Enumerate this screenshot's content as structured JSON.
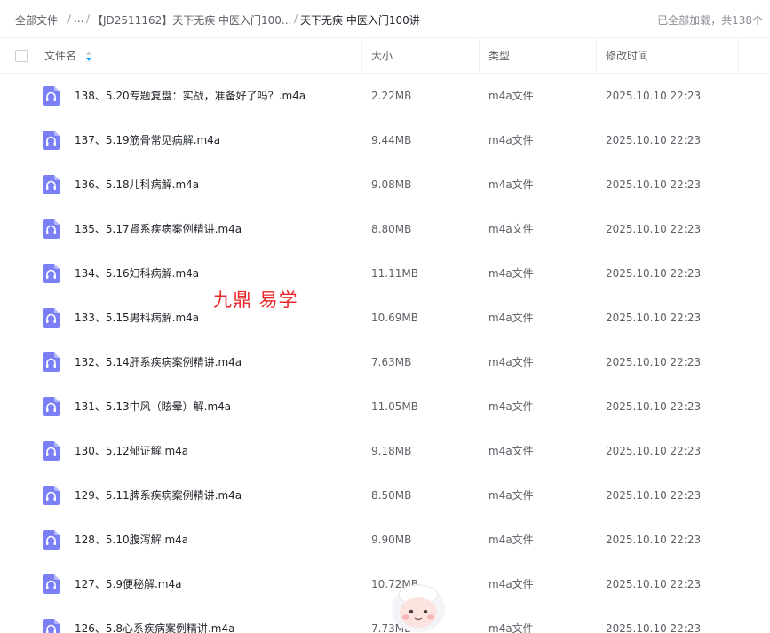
{
  "breadcrumb": {
    "root": "全部文件",
    "ellipsis": "...",
    "folder": "【JD2511162】天下无疾 中医入门100...",
    "current": "天下无疾 中医入门100讲",
    "separator": "/"
  },
  "load_status": "已全部加载，共138个",
  "columns": {
    "name": "文件名",
    "size": "大小",
    "type": "类型",
    "modified": "修改时间"
  },
  "files": [
    {
      "name": "138、5.20专题复盘：实战，准备好了吗？.m4a",
      "size": "2.22MB",
      "type": "m4a文件",
      "modified": "2025.10.10 22:23"
    },
    {
      "name": "137、5.19筋骨常见病解.m4a",
      "size": "9.44MB",
      "type": "m4a文件",
      "modified": "2025.10.10 22:23"
    },
    {
      "name": "136、5.18儿科病解.m4a",
      "size": "9.08MB",
      "type": "m4a文件",
      "modified": "2025.10.10 22:23"
    },
    {
      "name": "135、5.17肾系疾病案例精讲.m4a",
      "size": "8.80MB",
      "type": "m4a文件",
      "modified": "2025.10.10 22:23"
    },
    {
      "name": "134、5.16妇科病解.m4a",
      "size": "11.11MB",
      "type": "m4a文件",
      "modified": "2025.10.10 22:23"
    },
    {
      "name": "133、5.15男科病解.m4a",
      "size": "10.69MB",
      "type": "m4a文件",
      "modified": "2025.10.10 22:23"
    },
    {
      "name": "132、5.14肝系疾病案例精讲.m4a",
      "size": "7.63MB",
      "type": "m4a文件",
      "modified": "2025.10.10 22:23"
    },
    {
      "name": "131、5.13中风（眩晕）解.m4a",
      "size": "11.05MB",
      "type": "m4a文件",
      "modified": "2025.10.10 22:23"
    },
    {
      "name": "130、5.12郁证解.m4a",
      "size": "9.18MB",
      "type": "m4a文件",
      "modified": "2025.10.10 22:23"
    },
    {
      "name": "129、5.11脾系疾病案例精讲.m4a",
      "size": "8.50MB",
      "type": "m4a文件",
      "modified": "2025.10.10 22:23"
    },
    {
      "name": "128、5.10腹泻解.m4a",
      "size": "9.90MB",
      "type": "m4a文件",
      "modified": "2025.10.10 22:23"
    },
    {
      "name": "127、5.9便秘解.m4a",
      "size": "10.72MB",
      "type": "m4a文件",
      "modified": "2025.10.10 22:23"
    },
    {
      "name": "126、5.8心系疾病案例精讲.m4a",
      "size": "7.73MB",
      "type": "m4a文件",
      "modified": "2025.10.10 22:23"
    }
  ],
  "watermark": "九鼎 易学",
  "icons": {
    "file": "audio-file-icon",
    "sort": "sort-icon",
    "mascot": "assistant-mascot-icon"
  },
  "colors": {
    "accent": "#06a7ff",
    "file_icon": "#7b7ff5",
    "watermark": "#e8282b"
  }
}
